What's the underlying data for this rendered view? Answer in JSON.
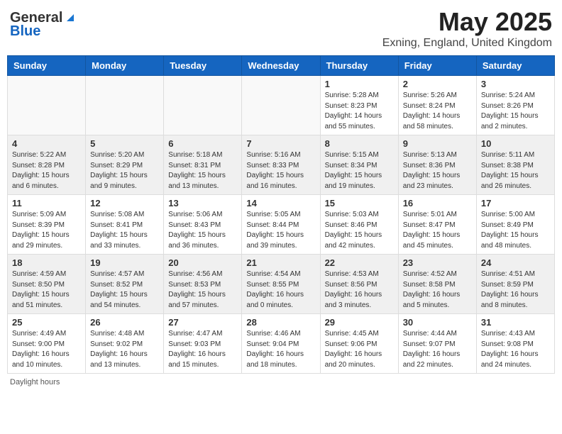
{
  "header": {
    "logo_general": "General",
    "logo_blue": "Blue",
    "month_title": "May 2025",
    "location": "Exning, England, United Kingdom"
  },
  "days_of_week": [
    "Sunday",
    "Monday",
    "Tuesday",
    "Wednesday",
    "Thursday",
    "Friday",
    "Saturday"
  ],
  "footer": {
    "daylight_label": "Daylight hours"
  },
  "weeks": [
    [
      {
        "day": "",
        "info": ""
      },
      {
        "day": "",
        "info": ""
      },
      {
        "day": "",
        "info": ""
      },
      {
        "day": "",
        "info": ""
      },
      {
        "day": "1",
        "info": "Sunrise: 5:28 AM\nSunset: 8:23 PM\nDaylight: 14 hours\nand 55 minutes."
      },
      {
        "day": "2",
        "info": "Sunrise: 5:26 AM\nSunset: 8:24 PM\nDaylight: 14 hours\nand 58 minutes."
      },
      {
        "day": "3",
        "info": "Sunrise: 5:24 AM\nSunset: 8:26 PM\nDaylight: 15 hours\nand 2 minutes."
      }
    ],
    [
      {
        "day": "4",
        "info": "Sunrise: 5:22 AM\nSunset: 8:28 PM\nDaylight: 15 hours\nand 6 minutes."
      },
      {
        "day": "5",
        "info": "Sunrise: 5:20 AM\nSunset: 8:29 PM\nDaylight: 15 hours\nand 9 minutes."
      },
      {
        "day": "6",
        "info": "Sunrise: 5:18 AM\nSunset: 8:31 PM\nDaylight: 15 hours\nand 13 minutes."
      },
      {
        "day": "7",
        "info": "Sunrise: 5:16 AM\nSunset: 8:33 PM\nDaylight: 15 hours\nand 16 minutes."
      },
      {
        "day": "8",
        "info": "Sunrise: 5:15 AM\nSunset: 8:34 PM\nDaylight: 15 hours\nand 19 minutes."
      },
      {
        "day": "9",
        "info": "Sunrise: 5:13 AM\nSunset: 8:36 PM\nDaylight: 15 hours\nand 23 minutes."
      },
      {
        "day": "10",
        "info": "Sunrise: 5:11 AM\nSunset: 8:38 PM\nDaylight: 15 hours\nand 26 minutes."
      }
    ],
    [
      {
        "day": "11",
        "info": "Sunrise: 5:09 AM\nSunset: 8:39 PM\nDaylight: 15 hours\nand 29 minutes."
      },
      {
        "day": "12",
        "info": "Sunrise: 5:08 AM\nSunset: 8:41 PM\nDaylight: 15 hours\nand 33 minutes."
      },
      {
        "day": "13",
        "info": "Sunrise: 5:06 AM\nSunset: 8:43 PM\nDaylight: 15 hours\nand 36 minutes."
      },
      {
        "day": "14",
        "info": "Sunrise: 5:05 AM\nSunset: 8:44 PM\nDaylight: 15 hours\nand 39 minutes."
      },
      {
        "day": "15",
        "info": "Sunrise: 5:03 AM\nSunset: 8:46 PM\nDaylight: 15 hours\nand 42 minutes."
      },
      {
        "day": "16",
        "info": "Sunrise: 5:01 AM\nSunset: 8:47 PM\nDaylight: 15 hours\nand 45 minutes."
      },
      {
        "day": "17",
        "info": "Sunrise: 5:00 AM\nSunset: 8:49 PM\nDaylight: 15 hours\nand 48 minutes."
      }
    ],
    [
      {
        "day": "18",
        "info": "Sunrise: 4:59 AM\nSunset: 8:50 PM\nDaylight: 15 hours\nand 51 minutes."
      },
      {
        "day": "19",
        "info": "Sunrise: 4:57 AM\nSunset: 8:52 PM\nDaylight: 15 hours\nand 54 minutes."
      },
      {
        "day": "20",
        "info": "Sunrise: 4:56 AM\nSunset: 8:53 PM\nDaylight: 15 hours\nand 57 minutes."
      },
      {
        "day": "21",
        "info": "Sunrise: 4:54 AM\nSunset: 8:55 PM\nDaylight: 16 hours\nand 0 minutes."
      },
      {
        "day": "22",
        "info": "Sunrise: 4:53 AM\nSunset: 8:56 PM\nDaylight: 16 hours\nand 3 minutes."
      },
      {
        "day": "23",
        "info": "Sunrise: 4:52 AM\nSunset: 8:58 PM\nDaylight: 16 hours\nand 5 minutes."
      },
      {
        "day": "24",
        "info": "Sunrise: 4:51 AM\nSunset: 8:59 PM\nDaylight: 16 hours\nand 8 minutes."
      }
    ],
    [
      {
        "day": "25",
        "info": "Sunrise: 4:49 AM\nSunset: 9:00 PM\nDaylight: 16 hours\nand 10 minutes."
      },
      {
        "day": "26",
        "info": "Sunrise: 4:48 AM\nSunset: 9:02 PM\nDaylight: 16 hours\nand 13 minutes."
      },
      {
        "day": "27",
        "info": "Sunrise: 4:47 AM\nSunset: 9:03 PM\nDaylight: 16 hours\nand 15 minutes."
      },
      {
        "day": "28",
        "info": "Sunrise: 4:46 AM\nSunset: 9:04 PM\nDaylight: 16 hours\nand 18 minutes."
      },
      {
        "day": "29",
        "info": "Sunrise: 4:45 AM\nSunset: 9:06 PM\nDaylight: 16 hours\nand 20 minutes."
      },
      {
        "day": "30",
        "info": "Sunrise: 4:44 AM\nSunset: 9:07 PM\nDaylight: 16 hours\nand 22 minutes."
      },
      {
        "day": "31",
        "info": "Sunrise: 4:43 AM\nSunset: 9:08 PM\nDaylight: 16 hours\nand 24 minutes."
      }
    ]
  ]
}
